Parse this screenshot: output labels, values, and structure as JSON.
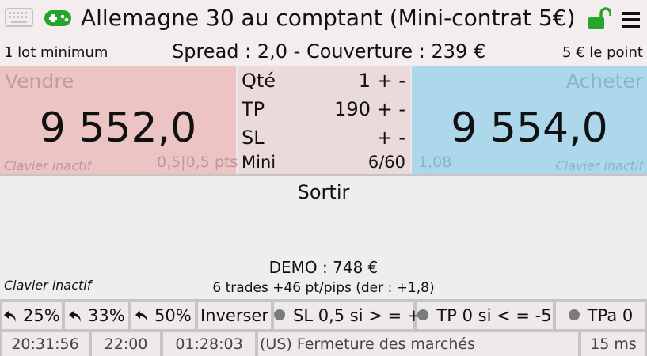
{
  "header": {
    "title": "Allemagne 30 au comptant (Mini-contrat 5€)",
    "lot_min": "1 lot minimum",
    "spread": "Spread : 2,0 - Couverture : 239 €",
    "per_point": "5 € le point"
  },
  "icons": {
    "keyboard": "keyboard-icon",
    "gamepad": "gamepad-icon",
    "lock": "unlocked-lock-icon",
    "menu": "hamburger-menu-icon"
  },
  "colors": {
    "sell": "#ecc4c4",
    "buy": "#add8eb",
    "gamepad": "#27a52b",
    "lock": "#27a52b"
  },
  "sell": {
    "label": "Vendre",
    "price": "9 552,0",
    "keyboard": "Clavier inactif",
    "pts": "0,5|0,5 pts"
  },
  "buy": {
    "label": "Acheter",
    "price": "9 554,0",
    "ratio": "1,08",
    "keyboard": "Clavier inactif"
  },
  "params": {
    "qty_label": "Qté",
    "qty_value": "1 + -",
    "tp_label": "TP",
    "tp_value": "190 + -",
    "sl_label": "SL",
    "sl_value": "+ -",
    "mini_label": "Mini",
    "mini_value": "6/60"
  },
  "exit": {
    "label": "Sortir",
    "demo": "DEMO : 748 €",
    "trades": "6 trades +46 pt/pips (der : +1,8)",
    "keyboard": "Clavier inactif"
  },
  "buttons": {
    "p25": "25%",
    "p33": "33%",
    "p50": "50%",
    "reverse": "Inverser",
    "sl_rule": "SL 0,5 si > = +",
    "tp_rule": "TP 0 si < = -5",
    "tpa": "TPa 0"
  },
  "status": {
    "time": "20:31:56",
    "close_time": "22:00",
    "countdown": "01:28:03",
    "market": "(US)  Fermeture des marchés",
    "latency": "15 ms"
  }
}
